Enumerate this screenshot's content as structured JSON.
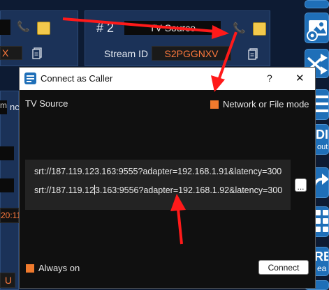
{
  "background": {
    "channel_number": "# 2",
    "channel_name": "TV Source",
    "stream_id_label": "Stream ID",
    "stream_id_value": "S2PGGNXV",
    "left_orange_fragment": "X",
    "left_time_fragment": "20:11",
    "left_u_fragment": "U",
    "left_nc_fragment": "nc",
    "left_tile_text": "m"
  },
  "right_tiles": {
    "tile3_text": "DI",
    "tile3_sub": "out",
    "tile6_text": "RE",
    "tile6_sub": "ea"
  },
  "dialog": {
    "title": "Connect as Caller",
    "help_label": "?",
    "close_label": "✕",
    "source_label": "TV Source",
    "network_mode_label": "Network or File mode",
    "urls": [
      "srt://187.119.123.163:9555?adapter=192.168.1.91&latency=300",
      "srt://187.119.12",
      "3.163:9556?adapter=192.168.1.92&latency=300"
    ],
    "more_button_label": "...",
    "always_on_label": "Always on",
    "connect_button_label": "Connect"
  },
  "colors": {
    "accent_orange": "#f07a2d",
    "annotation_red": "#ff1a1a",
    "channel_yellow": "#f2c94c",
    "tile_blue": "#1f6fb8"
  }
}
